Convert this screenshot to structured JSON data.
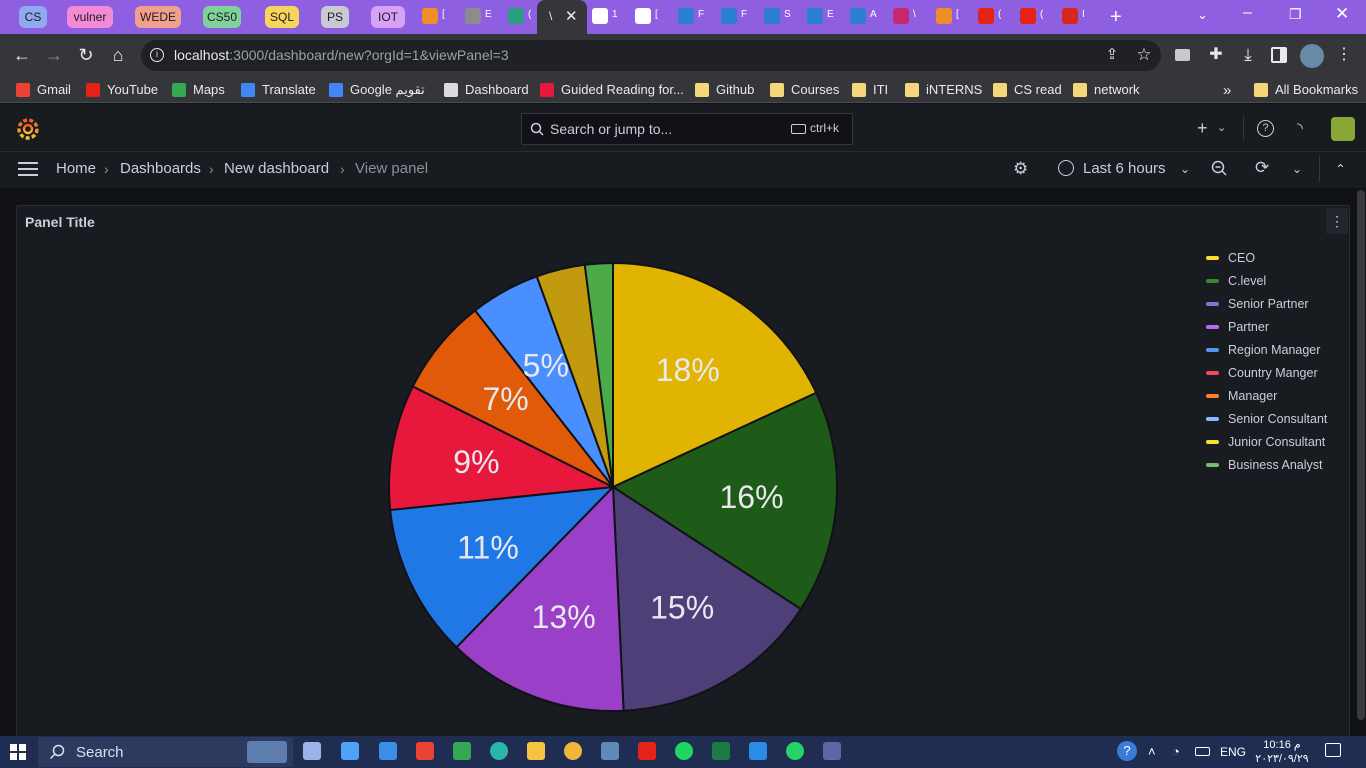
{
  "browser": {
    "pinned_tabs": [
      {
        "label": "CS",
        "color": "#8fa9f0"
      },
      {
        "label": "vulner",
        "color": "#f28ad6"
      },
      {
        "label": "WEDE",
        "color": "#f1a08e"
      },
      {
        "label": "CS50",
        "color": "#7fd39a"
      },
      {
        "label": "SQL",
        "color": "#f7d55c"
      },
      {
        "label": "PS",
        "color": "#c9c9d3"
      },
      {
        "label": "IOT",
        "color": "#d7a1f5"
      }
    ],
    "mini_tab_letters": [
      "[",
      "E",
      "(",
      "\\",
      "1",
      "[",
      "F",
      "F",
      "S",
      "E",
      "A",
      "\\",
      "[",
      "(",
      "(",
      "I"
    ],
    "url_host": "localhost",
    "url_rest": ":3000/dashboard/new?orgId=1&viewPanel=3",
    "bookmarks": [
      "Gmail",
      "YouTube",
      "Maps",
      "Translate",
      "Google تقويم",
      "Dashboard",
      "Guided Reading for...",
      "Github",
      "Courses",
      "ITI",
      "iNTERNS",
      "CS read",
      "network"
    ],
    "all_bookmarks": "All Bookmarks",
    "chevron": "»"
  },
  "grafana": {
    "search_placeholder": "Search or jump to...",
    "search_shortcut": "ctrl+k",
    "breadcrumb": [
      "Home",
      "Dashboards",
      "New dashboard",
      "View panel"
    ],
    "time_range": "Last 6 hours"
  },
  "panel": {
    "title": "Panel Title"
  },
  "chart_data": {
    "type": "pie",
    "categories": [
      "CEO",
      "C.level",
      "Senior Partner",
      "Partner",
      "Region Manager",
      "Country Manger",
      "Manager",
      "Senior Consultant",
      "Junior Consultant",
      "Business Analyst"
    ],
    "values": [
      18,
      16,
      15,
      13,
      11,
      9,
      7,
      5,
      3.5,
      2
    ],
    "data_labels": [
      "18%",
      "16%",
      "15%",
      "13%",
      "11%",
      "9%",
      "7%",
      "5%",
      "",
      ""
    ],
    "colors": [
      "#e0b400",
      "#1e5a18",
      "#4f3f78",
      "#9a40c8",
      "#1f78e6",
      "#e8173c",
      "#e05a0a",
      "#4a8fff",
      "#c29a0e",
      "#4caa48"
    ],
    "legend_colors": [
      "#fade2a",
      "#37872d",
      "#8f6fd6",
      "#ba6bf0",
      "#5794f2",
      "#f2495c",
      "#ff7f2a",
      "#8ab8ff",
      "#fade2a",
      "#73bf69"
    ],
    "legend_position": "right"
  },
  "taskbar": {
    "search_label": "Search",
    "lang": "ENG",
    "time": "10:16 م",
    "date": "٢٠٢٣/٠٩/٢٩"
  }
}
